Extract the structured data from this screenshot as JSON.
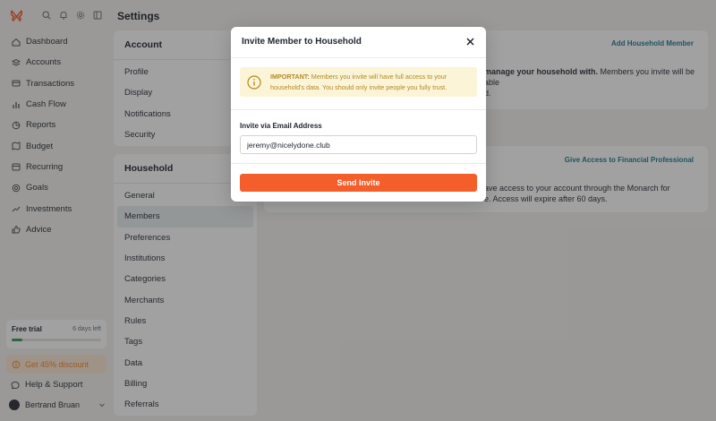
{
  "app": {
    "page_title": "Settings",
    "brand_color": "#f35e2a"
  },
  "sidebar": {
    "nav": [
      {
        "label": "Dashboard",
        "icon": "home-icon"
      },
      {
        "label": "Accounts",
        "icon": "layers-icon"
      },
      {
        "label": "Transactions",
        "icon": "credit-card-icon"
      },
      {
        "label": "Cash Flow",
        "icon": "bar-chart-icon"
      },
      {
        "label": "Reports",
        "icon": "pie-chart-icon"
      },
      {
        "label": "Budget",
        "icon": "map-icon"
      },
      {
        "label": "Recurring",
        "icon": "calendar-icon"
      },
      {
        "label": "Goals",
        "icon": "target-icon"
      },
      {
        "label": "Investments",
        "icon": "trending-up-icon"
      },
      {
        "label": "Advice",
        "icon": "thumbs-up-icon"
      }
    ],
    "trial": {
      "title": "Free trial",
      "days_left": "6 days left",
      "progress": 0.12
    },
    "discount_label": "Get 45% discount",
    "help_label": "Help & Support",
    "user_name": "Bertrand Bruan"
  },
  "settings": {
    "account": {
      "title": "Account",
      "items": [
        "Profile",
        "Display",
        "Notifications",
        "Security"
      ]
    },
    "household": {
      "title": "Household",
      "items": [
        "General",
        "Members",
        "Preferences",
        "Institutions",
        "Categories",
        "Merchants",
        "Rules",
        "Tags",
        "Data",
        "Billing",
        "Referrals"
      ],
      "active": "Members"
    }
  },
  "main": {
    "household_card": {
      "link": "Add Household Member",
      "text_line1_bold": "manage your household with.",
      "text_line1_rest": " Members you invite will be able",
      "text_line2": "d."
    },
    "pro_card": {
      "link": "Give Access to Financial Professional",
      "text_line1": "ave access to your account through the Monarch for",
      "text_line2": "e. Access will expire after 60 days."
    }
  },
  "modal": {
    "title": "Invite Member to Household",
    "notice_bold": "IMPORTANT:",
    "notice_text_1": " Members you invite will have full access to your",
    "notice_text_2": "household's data. You should only invite people you fully trust.",
    "field_label": "Invite via Email Address",
    "email_value": "jeremy@nicelydone.club",
    "send_label": "Send Invite"
  }
}
